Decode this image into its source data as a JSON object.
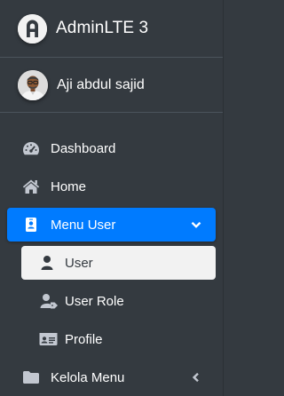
{
  "brand": {
    "title": "AdminLTE 3",
    "logo_icon": "adminlte-logo-icon"
  },
  "user": {
    "name": "Aji abdul sajid",
    "avatar_icon": "user-avatar"
  },
  "colors": {
    "sidebar_bg": "#343a40",
    "active_bg": "#007bff",
    "selected_sub_bg": "#f2f2f2",
    "text": "#c2c7d0"
  },
  "nav": {
    "items": [
      {
        "label": "Dashboard",
        "icon": "tachometer-icon"
      },
      {
        "label": "Home",
        "icon": "home-icon"
      },
      {
        "label": "Menu User",
        "icon": "id-badge-icon",
        "expanded": true,
        "arrow_icon": "chevron-down-icon"
      },
      {
        "label": "Kelola Menu",
        "icon": "folder-icon",
        "arrow_icon": "chevron-left-icon"
      }
    ],
    "submenu": [
      {
        "label": "User",
        "icon": "user-icon",
        "selected": true
      },
      {
        "label": "User Role",
        "icon": "user-tag-icon"
      },
      {
        "label": "Profile",
        "icon": "id-card-icon"
      }
    ]
  }
}
